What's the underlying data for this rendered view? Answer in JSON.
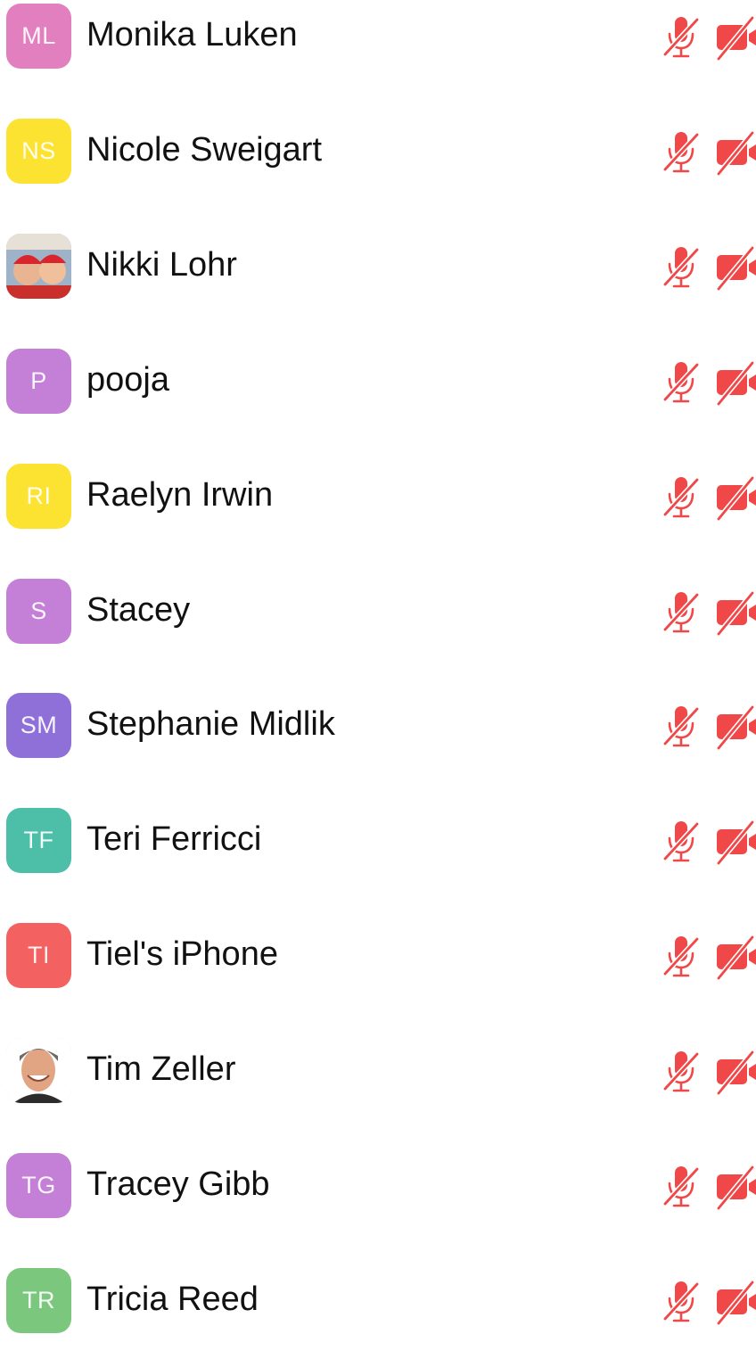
{
  "colors": {
    "status_red": "#f04848"
  },
  "participants": [
    {
      "name": "Monika Luken",
      "initials": "ML",
      "avatar_color": "#e27fbe",
      "avatar_type": "initials"
    },
    {
      "name": "Nicole Sweigart",
      "initials": "NS",
      "avatar_color": "#fce332",
      "avatar_type": "initials"
    },
    {
      "name": "Nikki Lohr",
      "initials": "",
      "avatar_color": "#cf3b3b",
      "avatar_type": "photo"
    },
    {
      "name": "pooja",
      "initials": "P",
      "avatar_color": "#c47fd6",
      "avatar_type": "initials"
    },
    {
      "name": "Raelyn Irwin",
      "initials": "RI",
      "avatar_color": "#fce332",
      "avatar_type": "initials"
    },
    {
      "name": "Stacey",
      "initials": "S",
      "avatar_color": "#c47fd6",
      "avatar_type": "initials"
    },
    {
      "name": "Stephanie Midlik",
      "initials": "SM",
      "avatar_color": "#8f6fd8",
      "avatar_type": "initials"
    },
    {
      "name": "Teri Ferricci",
      "initials": "TF",
      "avatar_color": "#4dbfa9",
      "avatar_type": "initials"
    },
    {
      "name": "Tiel's iPhone",
      "initials": "TI",
      "avatar_color": "#f36161",
      "avatar_type": "initials"
    },
    {
      "name": "Tim Zeller",
      "initials": "",
      "avatar_color": "#ffffff",
      "avatar_type": "photo"
    },
    {
      "name": "Tracey Gibb",
      "initials": "TG",
      "avatar_color": "#c47fd6",
      "avatar_type": "initials"
    },
    {
      "name": "Tricia Reed",
      "initials": "TR",
      "avatar_color": "#7cc77e",
      "avatar_type": "initials"
    }
  ],
  "icons": {
    "mic": "mic-muted-icon",
    "camera": "video-off-icon"
  }
}
